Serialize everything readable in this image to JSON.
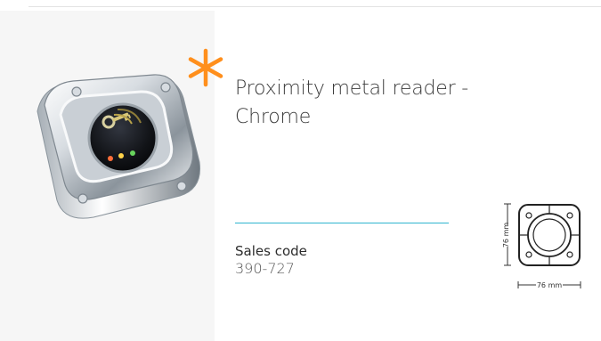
{
  "product": {
    "title": "Proximity metal reader - Chrome",
    "sales_code_label": "Sales code",
    "sales_code_value": "390-727"
  },
  "dimensions": {
    "width_label": "76 mm",
    "height_label": "76 mm"
  },
  "icons": {
    "highlight": "asterisk-icon",
    "product": "proximity-reader-image",
    "diagram": "dimension-drawing"
  },
  "colors": {
    "accent": "#ff8f1c",
    "rule": "#2fb4cf",
    "text": "#3b3b3b"
  }
}
